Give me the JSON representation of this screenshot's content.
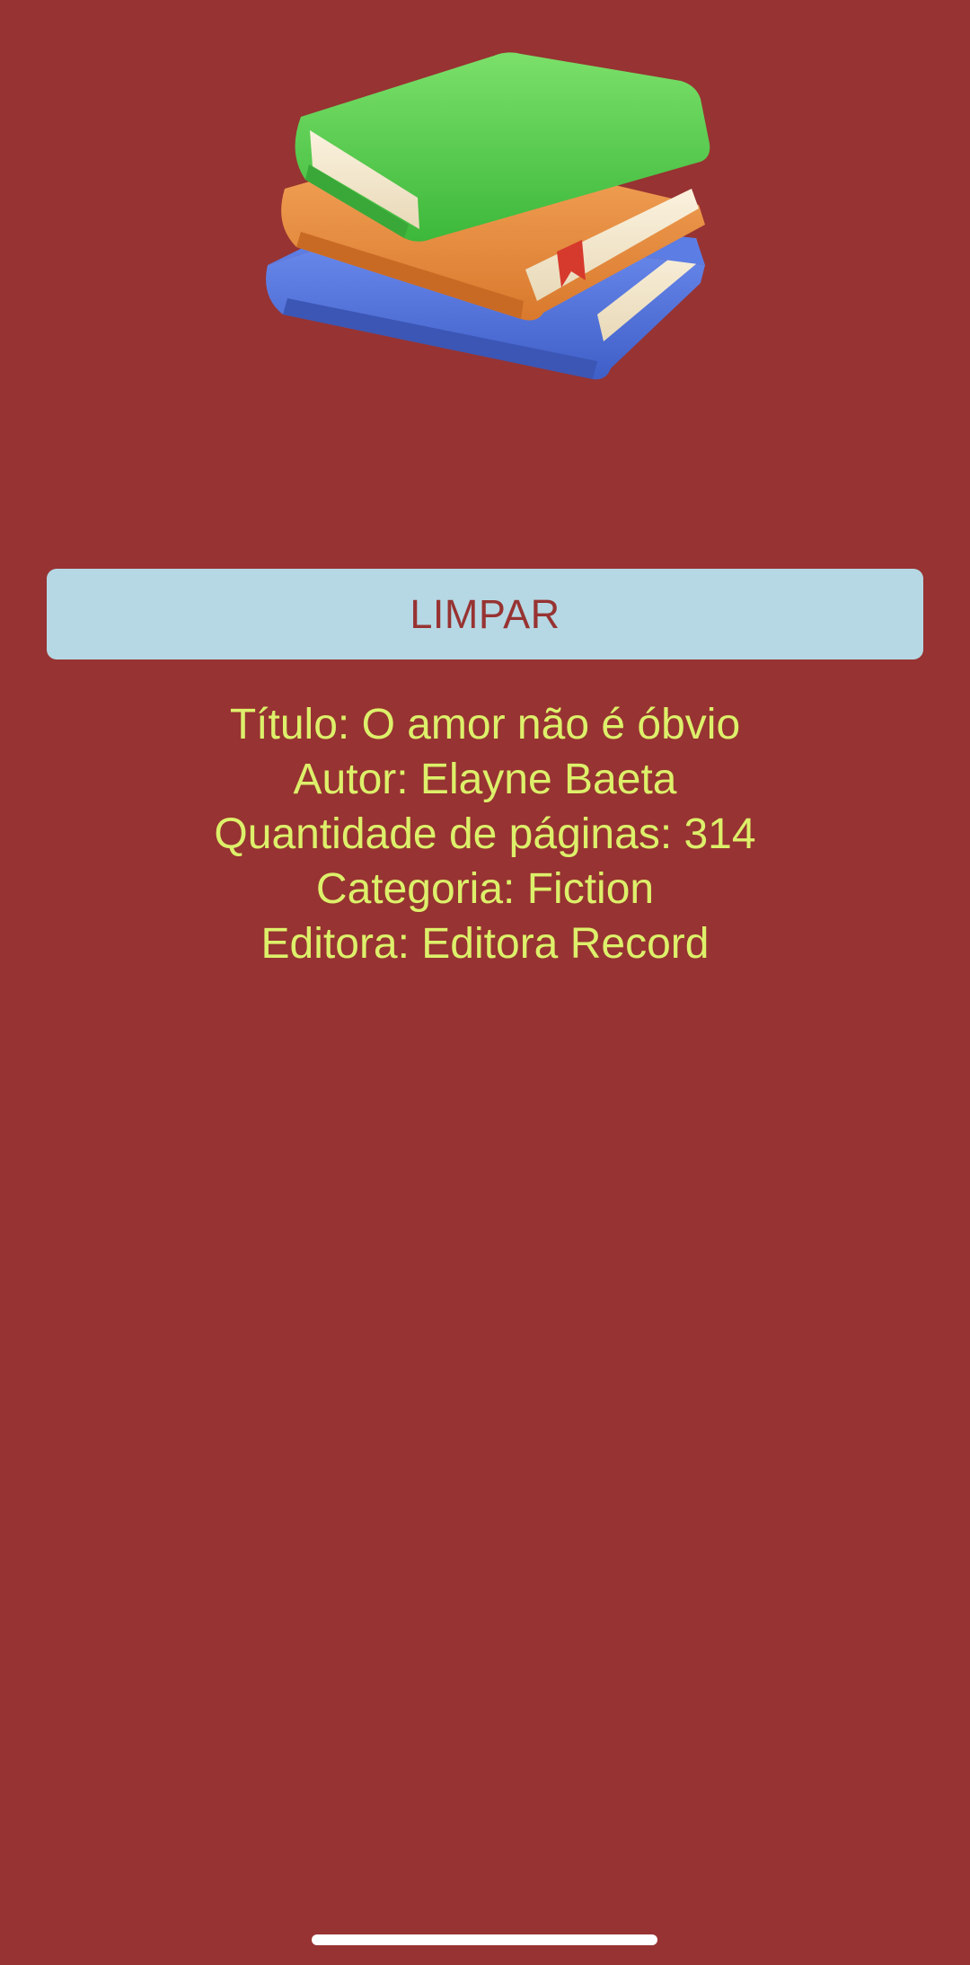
{
  "app": {
    "background_color": "#973332",
    "text_color": "#ddf06a",
    "button_color": "#b5d8e4"
  },
  "header": {
    "icon": "books-stack-icon"
  },
  "actions": {
    "clear_label": "LIMPAR"
  },
  "book": {
    "title_line": "Título: O amor não é óbvio",
    "author_line": "Autor: Elayne Baeta",
    "pages_line": "Quantidade de páginas: 314",
    "category_line": "Categoria: Fiction",
    "publisher_line": "Editora: Editora Record"
  }
}
